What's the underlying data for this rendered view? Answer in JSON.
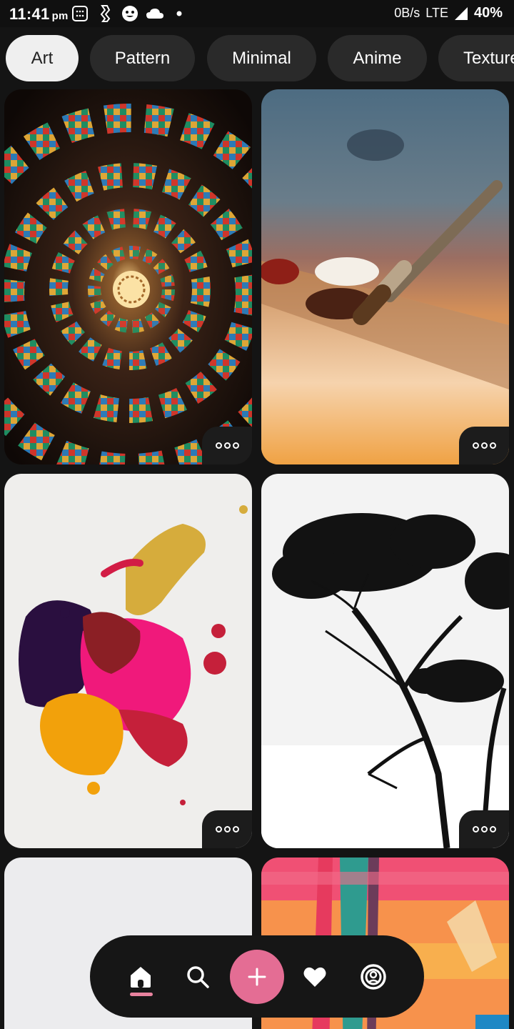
{
  "status_bar": {
    "time": "11:41",
    "ampm": "pm",
    "icons": [
      "calculator-icon",
      "vpn-key-icon",
      "face-icon",
      "cloud-icon",
      "dot-icon"
    ],
    "network_speed": "0B/s",
    "network_type": "LTE",
    "battery": "40%"
  },
  "categories": [
    {
      "label": "Art",
      "active": true
    },
    {
      "label": "Pattern",
      "active": false
    },
    {
      "label": "Minimal",
      "active": false
    },
    {
      "label": "Anime",
      "active": false
    },
    {
      "label": "Texture",
      "active": false
    }
  ],
  "wallpapers": [
    {
      "subject": "stained glass spiral",
      "more_icon": "more-dots-icon"
    },
    {
      "subject": "paint brush on palette",
      "more_icon": "more-dots-icon"
    },
    {
      "subject": "paint splash",
      "more_icon": "more-dots-icon"
    },
    {
      "subject": "tree silhouette",
      "more_icon": "more-dots-icon"
    },
    {
      "subject": "plain light grey"
    },
    {
      "subject": "abstract painted strokes"
    }
  ],
  "bottom_nav": {
    "items": [
      "home-icon",
      "search-icon",
      "add-icon",
      "heart-icon",
      "profile-icon"
    ],
    "active": "home",
    "accent_color": "#e46d94"
  }
}
